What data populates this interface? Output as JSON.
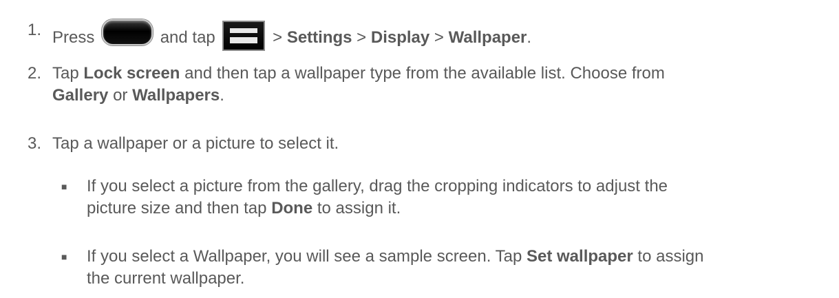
{
  "steps": [
    {
      "num": "1.",
      "press": "Press",
      "and_tap": "and tap",
      "sep1": ">",
      "settings": "Settings",
      "sep2": ">",
      "display": "Display",
      "sep3": ">",
      "wallpaper": "Wallpaper",
      "period": ".",
      "icons": [
        "home-key-icon",
        "menu-key-icon"
      ]
    },
    {
      "num": "2.",
      "tap": "Tap",
      "lock_screen": "Lock screen",
      "text1": "and then tap a wallpaper type from the available list. Choose from",
      "gallery": "Gallery",
      "or": "or",
      "wallpapers": "Wallpapers",
      "period": "."
    },
    {
      "num": "3.",
      "text": "Tap a wallpaper or a picture to select it."
    }
  ],
  "bullets": [
    {
      "mark": "■",
      "text1": "If you select a picture from the gallery, drag the cropping indicators to adjust the",
      "text2": "picture size and then tap",
      "done": "Done",
      "text3": "to assign it."
    },
    {
      "mark": "■",
      "text1": "If you select a Wallpaper, you will see a sample screen. Tap",
      "set_wallpaper": "Set wallpaper",
      "text2": "to assign",
      "text3": "the current wallpaper."
    }
  ]
}
